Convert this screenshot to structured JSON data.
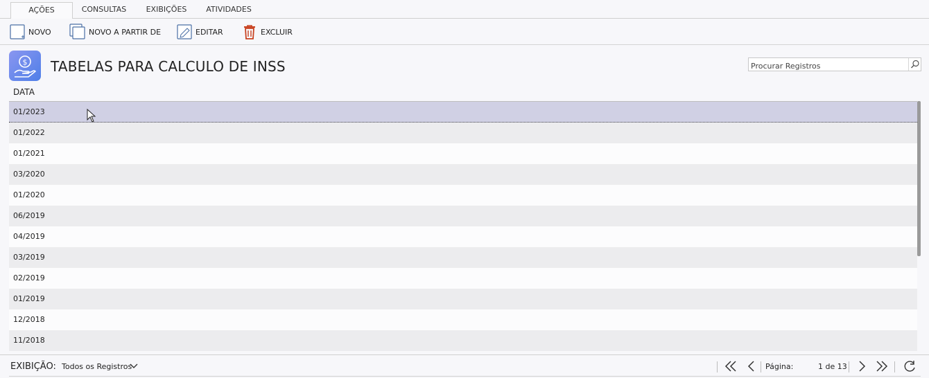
{
  "tabs": [
    {
      "label": "AÇÕES",
      "active": true
    },
    {
      "label": "CONSULTAS",
      "active": false
    },
    {
      "label": "EXIBIÇÕES",
      "active": false
    },
    {
      "label": "ATIVIDADES",
      "active": false
    }
  ],
  "toolbar": {
    "new_label": "NOVO",
    "new_from_label": "NOVO A PARTIR DE",
    "edit_label": "EDITAR",
    "delete_label": "EXCLUIR",
    "delete_color": "#c8401e"
  },
  "header": {
    "title": "TABELAS PARA CALCULO DE INSS",
    "icon": "money-hand-icon"
  },
  "search": {
    "placeholder": "Procurar Registros",
    "icon": "search-icon"
  },
  "grid": {
    "column_header": "DATA",
    "rows": [
      "01/2023",
      "01/2022",
      "01/2021",
      "03/2020",
      "01/2020",
      "06/2019",
      "04/2019",
      "03/2019",
      "02/2019",
      "01/2019",
      "12/2018",
      "11/2018"
    ],
    "selected_index": 0
  },
  "footer": {
    "view_label": "EXIBIÇÃO:",
    "view_value": "Todos os Registros",
    "page_label": "Página:",
    "page_value": "1 de 13"
  },
  "colors": {
    "accent_icon_start": "#8a96f0",
    "accent_icon_end": "#4f7fe8",
    "selected_row": "#d0d0e4"
  }
}
